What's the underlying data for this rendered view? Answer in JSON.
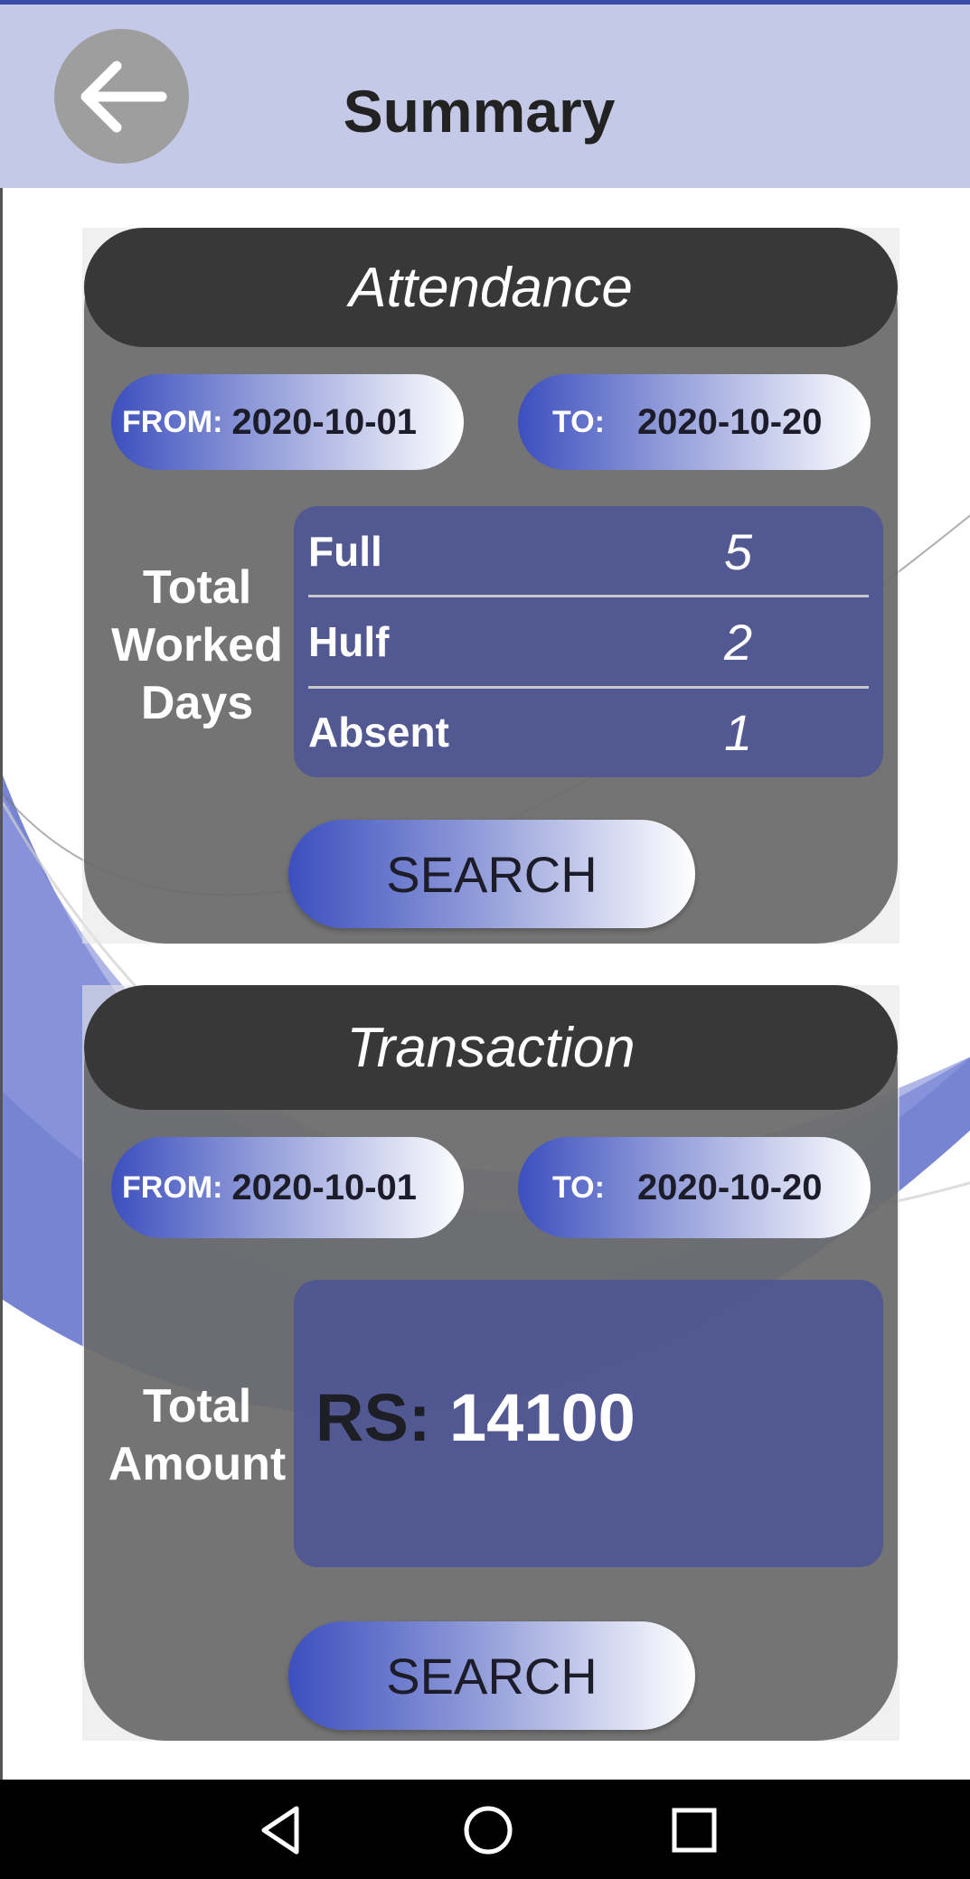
{
  "header": {
    "title": "Summary",
    "back_icon": "arrow-left-icon"
  },
  "attendance": {
    "title": "Attendance",
    "from_label": "FROM:",
    "from_value": "2020-10-01",
    "to_label": "TO:",
    "to_value": "2020-10-20",
    "summary_label": "Total Worked Days",
    "rows": [
      {
        "name": "Full",
        "value": "5"
      },
      {
        "name": "Hulf",
        "value": "2"
      },
      {
        "name": "Absent",
        "value": "1"
      }
    ],
    "search_label": "SEARCH"
  },
  "transaction": {
    "title": "Transaction",
    "from_label": "FROM:",
    "from_value": "2020-10-01",
    "to_label": "TO:",
    "to_value": "2020-10-20",
    "summary_label": "Total Amount",
    "currency": "RS:",
    "amount": "14100",
    "search_label": "SEARCH"
  },
  "navbar": {
    "back": "nav-back-icon",
    "home": "nav-home-icon",
    "recents": "nav-recents-icon"
  },
  "colors": {
    "header_bg": "#c5c9e8",
    "accent": "#3c4fbe",
    "card_bg": "#606060",
    "card_head": "#383838"
  }
}
